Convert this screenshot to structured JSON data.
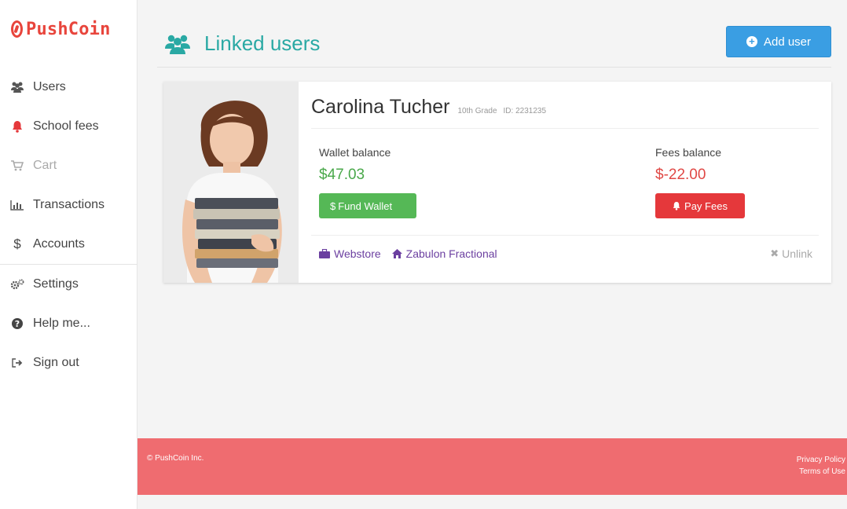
{
  "brand": {
    "name": "PushCoin"
  },
  "nav": {
    "items": [
      {
        "label": "Users",
        "icon": "users-icon"
      },
      {
        "label": "School fees",
        "icon": "bell-icon"
      },
      {
        "label": "Cart",
        "icon": "cart-icon"
      },
      {
        "label": "Transactions",
        "icon": "chart-icon"
      },
      {
        "label": "Accounts",
        "icon": "dollar-icon"
      },
      {
        "label": "Settings",
        "icon": "gears-icon"
      },
      {
        "label": "Help me...",
        "icon": "question-icon"
      },
      {
        "label": "Sign out",
        "icon": "sign-out-icon"
      }
    ]
  },
  "header": {
    "title": "Linked users",
    "add_user_label": "Add user"
  },
  "user": {
    "name": "Carolina Tucher",
    "grade": "10th Grade",
    "id": "ID: 2231235",
    "wallet": {
      "label": "Wallet balance",
      "value": "$47.03",
      "button": "Fund Wallet"
    },
    "fees": {
      "label": "Fees balance",
      "value": "$-22.00",
      "button": "Pay Fees"
    },
    "links": {
      "webstore": "Webstore",
      "school": "Zabulon Fractional",
      "unlink": "Unlink"
    }
  },
  "footer": {
    "copyright": "© PushCoin Inc.",
    "privacy": "Privacy Policy",
    "terms": "Terms of Use"
  },
  "colors": {
    "brand": "#e8453c",
    "title": "#2aa9a4",
    "primary": "#3a9ee3",
    "success": "#55b856",
    "danger": "#e5383b",
    "footer": "#ef6c70",
    "link": "#6b3fa0"
  }
}
